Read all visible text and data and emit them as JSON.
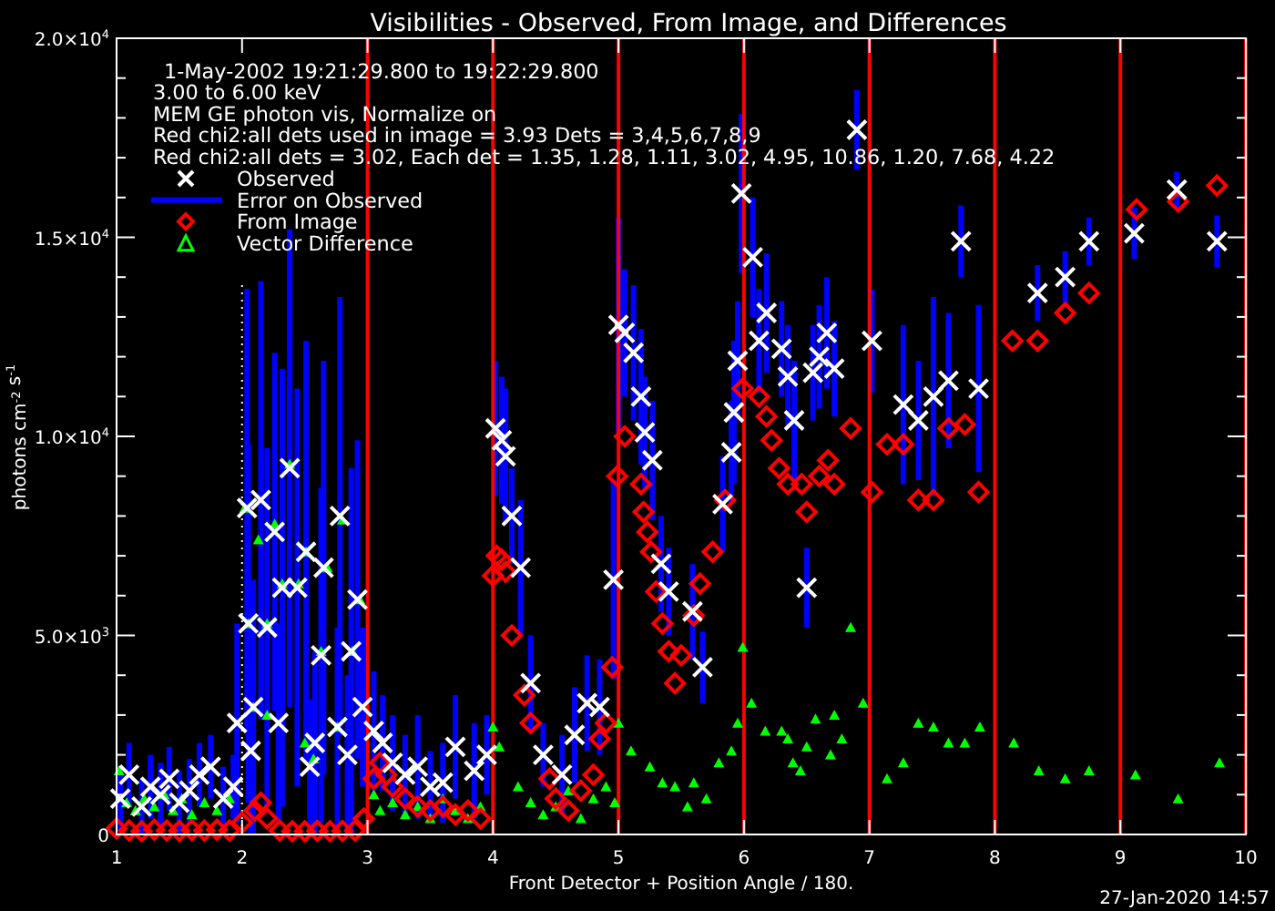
{
  "plot": {
    "info_lines": [
      "1-May-2002 19:21:29.800 to 19:22:29.800",
      "3.00 to 6.00 keV",
      "MEM GE photon vis,   Normalize on",
      "Red chi2:all dets used in image = 3.93  Dets = 3,4,5,6,7,8,9",
      "Red chi2:all dets = 3.02,  Each det = 1.35, 1.28, 1.11, 3.02, 4.95, 10.86, 1.20, 7.68, 4.22"
    ],
    "date": "27-Jan-2020 14:57",
    "legend": [
      {
        "label": "Observed",
        "color": "#ffffff"
      },
      {
        "label": "Error on Observed",
        "color": "#0000ff"
      },
      {
        "label": "From Image",
        "color": "#ff0000"
      },
      {
        "label": "Vector Difference",
        "color": "#00ff00"
      }
    ],
    "chart_data": {
      "type": "scatter",
      "title": "Visibilities - Observed, From Image, and Differences",
      "xlabel": "Front Detector + Position Angle / 180.",
      "ylabel": "photons cm$^{-2}$ s$^{-1}$",
      "xlim": [
        1,
        10
      ],
      "ylim": [
        0,
        20000
      ],
      "xticks": [
        {
          "value": 1,
          "label": "1"
        },
        {
          "value": 2,
          "label": "2"
        },
        {
          "value": 3,
          "label": "3"
        },
        {
          "value": 4,
          "label": "4"
        },
        {
          "value": 5,
          "label": "5"
        },
        {
          "value": 6,
          "label": "6"
        },
        {
          "value": 7,
          "label": "7"
        },
        {
          "value": 8,
          "label": "8"
        },
        {
          "value": 9,
          "label": "9"
        },
        {
          "value": 10,
          "label": "10"
        }
      ],
      "yticks": [
        {
          "value": 0,
          "label": "0"
        },
        {
          "value": 5000,
          "label": "5.0×10$^{3}$"
        },
        {
          "value": 10000,
          "label": "1.0×10$^{4}$"
        },
        {
          "value": 15000,
          "label": "1.5×10$^{4}$"
        },
        {
          "value": 20000,
          "label": "2.0×10$^{4}$"
        }
      ],
      "ref_lines": [
        {
          "axis": "x",
          "value": 2.0,
          "color": "#ffffff"
        }
      ],
      "grid": true,
      "series": [
        {
          "color": "#ffffff",
          "x": [
            1.03,
            1.1,
            1.2,
            1.27,
            1.35,
            1.42,
            1.5,
            1.58,
            1.66,
            1.75,
            1.85,
            1.93,
            1.96,
            2.04,
            2.05,
            2.07,
            2.09,
            2.15,
            2.2,
            2.26,
            2.29,
            2.32,
            2.38,
            2.44,
            2.51,
            2.54,
            2.58,
            2.63,
            2.65,
            2.76,
            2.78,
            2.84,
            2.87,
            2.92,
            2.96,
            3.05,
            3.12,
            3.2,
            3.3,
            3.4,
            3.5,
            3.6,
            3.7,
            3.85,
            3.95,
            4.02,
            4.07,
            4.1,
            4.15,
            4.22,
            4.3,
            4.4,
            4.55,
            4.65,
            4.75,
            4.85,
            4.96,
            5.0,
            5.05,
            5.12,
            5.18,
            5.21,
            5.27,
            5.34,
            5.4,
            5.59,
            5.67,
            5.83,
            5.9,
            5.92,
            5.95,
            5.98,
            6.07,
            6.12,
            6.18,
            6.3,
            6.35,
            6.4,
            6.5,
            6.55,
            6.6,
            6.66,
            6.72,
            6.9,
            7.02,
            7.27,
            7.39,
            7.51,
            7.63,
            7.73,
            7.87,
            8.34,
            8.56,
            8.75,
            9.11,
            9.45,
            9.77
          ],
          "values": [
            900,
            1500,
            700,
            1200,
            1000,
            1400,
            800,
            1100,
            1500,
            1700,
            900,
            1200,
            2800,
            8200,
            5300,
            2100,
            3200,
            8400,
            5200,
            7600,
            2800,
            6200,
            9200,
            6200,
            7100,
            1700,
            2300,
            4500,
            6700,
            2700,
            8000,
            2000,
            4600,
            5900,
            3200,
            2600,
            2300,
            1800,
            1500,
            1700,
            1200,
            1300,
            2200,
            1600,
            2000,
            10200,
            9900,
            9500,
            8000,
            6700,
            3800,
            2000,
            1500,
            2500,
            3300,
            3200,
            6400,
            12800,
            12600,
            12100,
            11000,
            10100,
            9400,
            6800,
            6100,
            5600,
            4200,
            8300,
            9600,
            10600,
            11900,
            16100,
            14500,
            12400,
            13100,
            12200,
            11500,
            10400,
            6200,
            11600,
            12000,
            12600,
            11700,
            17700,
            12400,
            10800,
            10400,
            11000,
            11400,
            14900,
            11200,
            13600,
            14000,
            14900,
            15100,
            16200,
            14900
          ],
          "errors": [
            800,
            800,
            700,
            800,
            800,
            800,
            800,
            800,
            800,
            800,
            800,
            800,
            2500,
            5500,
            4500,
            2100,
            3200,
            5500,
            4500,
            4500,
            2500,
            5500,
            6000,
            5000,
            5300,
            1700,
            2300,
            4200,
            5200,
            2500,
            5500,
            2000,
            4600,
            4000,
            2000,
            1500,
            1200,
            1200,
            1000,
            1300,
            900,
            1000,
            1300,
            1200,
            1000,
            1700,
            1600,
            1700,
            1200,
            1700,
            1200,
            800,
            1000,
            1200,
            1200,
            1200,
            2500,
            2700,
            1600,
            1700,
            1700,
            1400,
            1500,
            1200,
            1100,
            1200,
            900,
            1200,
            1300,
            1800,
            1500,
            2000,
            1500,
            1300,
            1500,
            1200,
            1300,
            1500,
            1000,
            1200,
            1300,
            1400,
            1200,
            1000,
            1300,
            2000,
            1500,
            2500,
            1700,
            900,
            2100,
            700,
            650,
            600,
            650,
            450,
            650
          ]
        },
        {
          "color": "#ff0000",
          "x": [
            1.0,
            1.1,
            1.2,
            1.3,
            1.4,
            1.5,
            1.6,
            1.7,
            1.8,
            1.9,
            2.0,
            2.1,
            2.15,
            2.2,
            2.3,
            2.4,
            2.5,
            2.6,
            2.7,
            2.8,
            2.9,
            2.97,
            3.05,
            3.1,
            3.15,
            3.2,
            3.3,
            3.4,
            3.5,
            3.6,
            3.7,
            3.8,
            3.9,
            4.0,
            4.03,
            4.07,
            4.1,
            4.15,
            4.25,
            4.3,
            4.45,
            4.5,
            4.6,
            4.7,
            4.8,
            4.85,
            4.9,
            4.95,
            4.99,
            5.05,
            5.18,
            5.2,
            5.23,
            5.26,
            5.3,
            5.35,
            5.4,
            5.45,
            5.5,
            5.6,
            5.65,
            5.75,
            5.85,
            5.99,
            6.12,
            6.18,
            6.22,
            6.28,
            6.35,
            6.46,
            6.5,
            6.6,
            6.67,
            6.72,
            6.85,
            7.02,
            7.14,
            7.27,
            7.39,
            7.51,
            7.63,
            7.76,
            7.87,
            8.14,
            8.34,
            8.56,
            8.75,
            9.13,
            9.46,
            9.77
          ],
          "values": [
            150,
            100,
            80,
            120,
            100,
            90,
            110,
            100,
            120,
            100,
            300,
            600,
            800,
            400,
            100,
            80,
            80,
            90,
            80,
            90,
            100,
            400,
            1400,
            1800,
            1500,
            1200,
            900,
            700,
            600,
            700,
            500,
            600,
            400,
            6500,
            7000,
            6900,
            6600,
            5000,
            3500,
            2800,
            1400,
            900,
            600,
            1100,
            1500,
            2400,
            2800,
            4200,
            9000,
            10000,
            8800,
            8100,
            7600,
            7100,
            6100,
            5300,
            4600,
            3800,
            4500,
            5500,
            6300,
            7100,
            8400,
            11200,
            11000,
            10500,
            9900,
            9200,
            8800,
            8800,
            8100,
            9000,
            9400,
            8800,
            10200,
            8600,
            9800,
            9800,
            8400,
            8400,
            10200,
            10300,
            8600,
            12400,
            12400,
            13100,
            13600,
            15700,
            15900,
            16300
          ]
        },
        {
          "color": "#00ff00",
          "x": [
            1.02,
            1.08,
            1.15,
            1.22,
            1.3,
            1.38,
            1.45,
            1.52,
            1.6,
            1.7,
            1.8,
            1.9,
            2.02,
            2.05,
            2.09,
            2.13,
            2.2,
            2.26,
            2.32,
            2.38,
            2.45,
            2.51,
            2.57,
            2.63,
            2.68,
            2.76,
            2.8,
            2.88,
            2.94,
            2.2,
            2.5,
            3.05,
            3.1,
            3.2,
            3.3,
            3.4,
            3.5,
            3.6,
            3.7,
            3.8,
            3.9,
            4.0,
            4.05,
            4.2,
            4.3,
            4.4,
            4.5,
            4.6,
            4.7,
            4.8,
            4.9,
            4.97,
            5.0,
            5.1,
            5.25,
            5.35,
            5.45,
            5.55,
            5.6,
            5.7,
            5.8,
            5.9,
            5.95,
            5.99,
            6.06,
            6.17,
            6.3,
            6.35,
            6.39,
            6.45,
            6.5,
            6.57,
            6.69,
            6.72,
            6.78,
            6.85,
            6.95,
            7.14,
            7.27,
            7.39,
            7.51,
            7.63,
            7.76,
            7.88,
            8.15,
            8.35,
            8.56,
            8.75,
            9.12,
            9.46,
            9.79
          ],
          "values": [
            1600,
            800,
            600,
            900,
            700,
            1000,
            600,
            900,
            500,
            800,
            600,
            900,
            8200,
            5300,
            3200,
            7400,
            5300,
            7800,
            6300,
            9300,
            6300,
            7100,
            1900,
            4600,
            6700,
            2700,
            7900,
            4600,
            5900,
            3000,
            2300,
            1000,
            600,
            800,
            500,
            700,
            400,
            900,
            600,
            400,
            700,
            2700,
            2200,
            1200,
            800,
            500,
            700,
            1100,
            400,
            900,
            1200,
            800,
            2800,
            2100,
            1700,
            1300,
            1200,
            700,
            1300,
            900,
            1800,
            2100,
            2800,
            4700,
            3300,
            2600,
            2600,
            2400,
            1800,
            1600,
            2200,
            2900,
            2000,
            3000,
            2400,
            5200,
            3300,
            1400,
            1800,
            2800,
            2700,
            2300,
            2300,
            2700,
            2300,
            1600,
            1400,
            1600,
            1500,
            900,
            1800
          ]
        }
      ]
    }
  }
}
